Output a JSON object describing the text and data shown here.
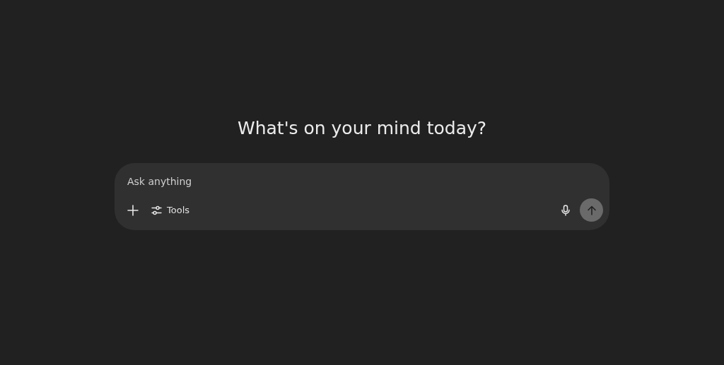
{
  "heading": "What's on your mind today?",
  "composer": {
    "placeholder": "Ask anything",
    "tools_label": "Tools",
    "send_disabled": true
  }
}
